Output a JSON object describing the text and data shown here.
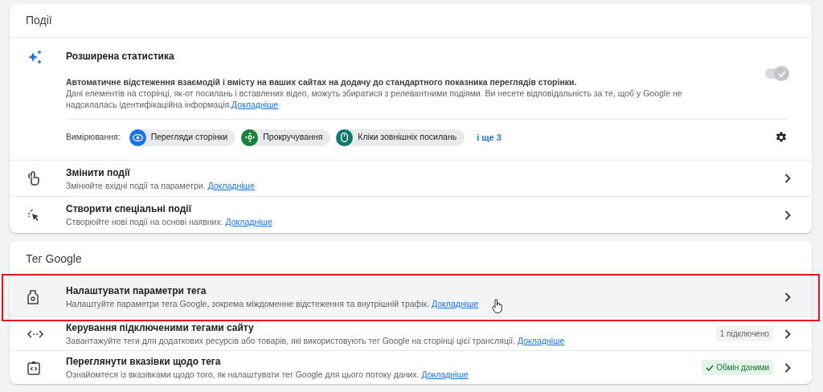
{
  "events_card": {
    "title": "Події",
    "enhanced": {
      "title": "Розширена статистика",
      "description_bold": "Автоматичне відстеження взаємодій і вмісту на ваших сайтах на додачу до стандартного показника переглядів сторінки.",
      "description": "Дані елементів на сторінці, як-от посилань і вставлених відео, можуть збиратися з релевантними подіями. Ви несете відповідальність за те, щоб у Google не надсилалась ідентифікаційна інформація.",
      "link": "Докладніше",
      "toggle": {
        "on": true,
        "disabled": true
      },
      "measurements_label": "Вимірювання:",
      "measurements": [
        {
          "label": "Перегляди сторінки",
          "color": "#1a73e8"
        },
        {
          "label": "Прокручування",
          "color": "#188038"
        },
        {
          "label": "Кліки зовнішніх посилань",
          "color": "#12796f"
        }
      ],
      "more": "і ще 3"
    },
    "rows": [
      {
        "title": "Змінити події",
        "description": "Змінюйте вхідні події та параметри.",
        "link": "Докладніше",
        "hovered": false
      },
      {
        "title": "Створити спеціальні події",
        "description": "Створюйте нові події на основі наявних.",
        "link": "Докладніше",
        "hovered": false
      }
    ]
  },
  "tag_card": {
    "title": "Тег Google",
    "rows": [
      {
        "title": "Налаштувати параметри тега",
        "description": "Налаштуйте параметри тега Google, зокрема міждоменне відстеження та внутрішній трафік.",
        "link": "Докладніше",
        "hovered": true
      },
      {
        "title": "Керування підключеними тегами сайту",
        "description": "Завантажуйте теги для додаткових ресурсів або товарів, які використовують тег Google на сторінці цієї трансляції.",
        "link": "Докладніше",
        "hovered": false,
        "badge": {
          "text": "1 підключено",
          "kind": "neutral"
        }
      },
      {
        "title": "Переглянути вказівки щодо тега",
        "description": "Ознайомтеся із вказівками щодо того, як налаштувати тег Google для цього потоку даних.",
        "link": "Докладніше",
        "hovered": false,
        "badge": {
          "text": "Обмін даними",
          "kind": "success"
        }
      }
    ]
  }
}
